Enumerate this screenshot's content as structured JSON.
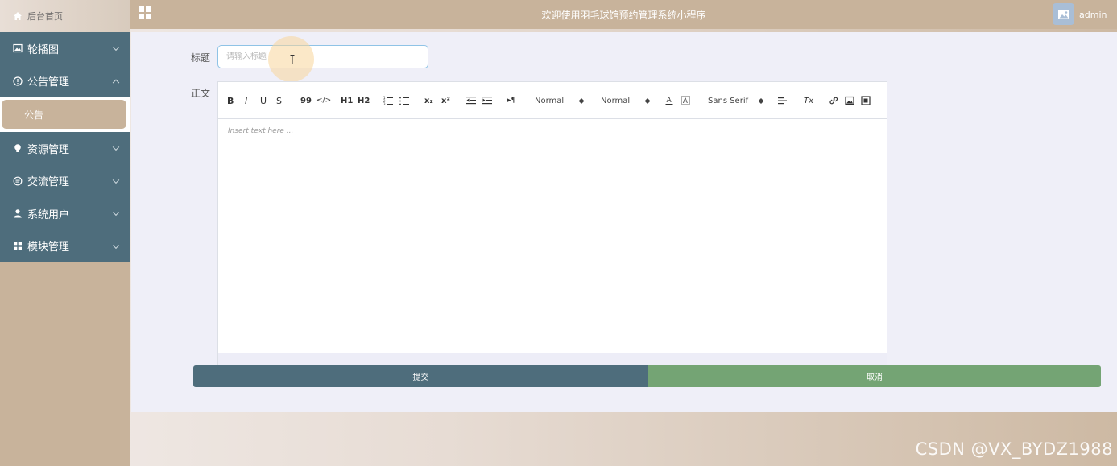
{
  "sidebar": {
    "home_label": "后台首页",
    "items": [
      {
        "label": "轮播图",
        "icon": "image-icon",
        "expanded": false
      },
      {
        "label": "公告管理",
        "icon": "info-circle-icon",
        "expanded": true,
        "sub_items": [
          {
            "label": "公告",
            "active": true
          }
        ]
      },
      {
        "label": "资源管理",
        "icon": "lightbulb-icon",
        "expanded": false
      },
      {
        "label": "交流管理",
        "icon": "chat-icon",
        "expanded": false
      },
      {
        "label": "系统用户",
        "icon": "user-icon",
        "expanded": false
      },
      {
        "label": "模块管理",
        "icon": "grid-icon",
        "expanded": false
      }
    ]
  },
  "header": {
    "title": "欢迎使用羽毛球馆预约管理系统小程序",
    "username": "admin"
  },
  "form": {
    "title_label": "标题",
    "title_placeholder": "请输入标题",
    "title_value": "",
    "body_label": "正文",
    "editor_placeholder": "Insert text here ...",
    "toolbar": {
      "bold": "B",
      "italic": "I",
      "underline": "U",
      "strike": "S",
      "blockquote": "99",
      "code": "</>",
      "h1": "H1",
      "h2": "H2",
      "subscript": "x₂",
      "superscript": "x²",
      "direction": "▸¶",
      "size_value": "Normal",
      "header_value": "Normal",
      "font_value": "Sans Serif",
      "clean": "Tx"
    },
    "submit_label": "提交",
    "cancel_label": "取消"
  },
  "watermark": "CSDN @VX_BYDZ1988",
  "colors": {
    "sidebar_menu": "#4e6d7c",
    "accent_tan": "#c8b39b",
    "submit": "#4e6d7c",
    "cancel": "#74a474",
    "content_bg": "#efeff8"
  }
}
